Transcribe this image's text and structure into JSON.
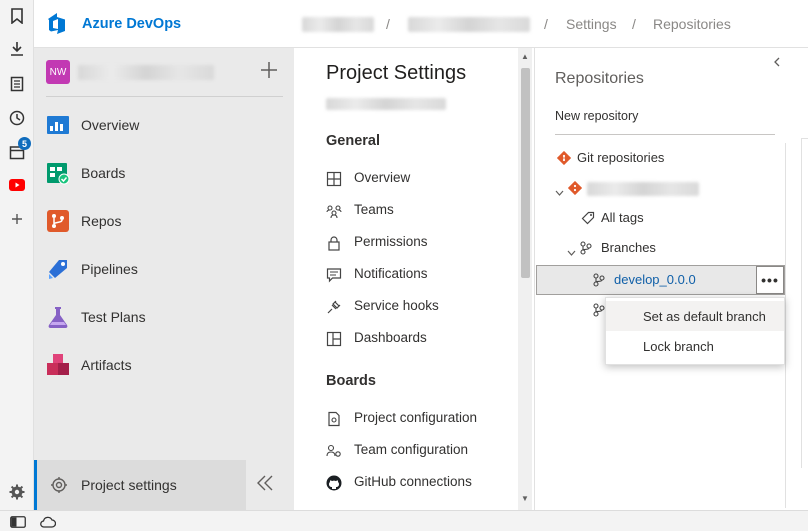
{
  "rail": {
    "calendar_badge": "5"
  },
  "header": {
    "brand": "Azure DevOps",
    "breadcrumbs": [
      "Settings",
      "Repositories"
    ]
  },
  "project": {
    "avatar": "NW"
  },
  "nav": {
    "items": [
      {
        "label": "Overview",
        "icon": "overview-icon",
        "color": "#0078d4"
      },
      {
        "label": "Boards",
        "icon": "boards-icon",
        "color": "#009a6d"
      },
      {
        "label": "Repos",
        "icon": "repos-icon",
        "color": "#e05a2b"
      },
      {
        "label": "Pipelines",
        "icon": "pipelines-icon",
        "color": "#2b6fd6"
      },
      {
        "label": "Test Plans",
        "icon": "test-plans-icon",
        "color": "#8661c5"
      },
      {
        "label": "Artifacts",
        "icon": "artifacts-icon",
        "color": "#c92e5a"
      }
    ],
    "project_settings": "Project settings"
  },
  "settings": {
    "title": "Project Settings",
    "general_heading": "General",
    "general": [
      "Overview",
      "Teams",
      "Permissions",
      "Notifications",
      "Service hooks",
      "Dashboards"
    ],
    "boards_heading": "Boards",
    "boards": [
      "Project configuration",
      "Team configuration",
      "GitHub connections"
    ]
  },
  "repos": {
    "title": "Repositories",
    "new_repository": "New repository",
    "git_repositories": "Git repositories",
    "all_tags": "All tags",
    "branches": "Branches",
    "selected_branch": "develop_0.0.0",
    "more_label": "•••"
  },
  "context_menu": {
    "items": [
      "Set as default branch",
      "Lock branch"
    ]
  }
}
